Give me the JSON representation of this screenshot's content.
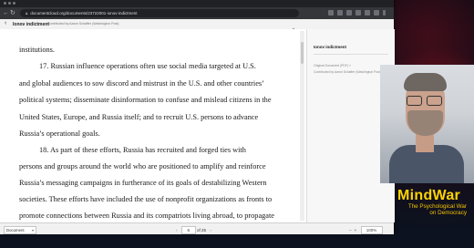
{
  "browser": {
    "url": "documentcloud.org/documents/23722001-ionov-indictment",
    "url_prefix_icon": "lock-icon"
  },
  "viewer": {
    "title": "Ionov indictment",
    "contributor": "Contributed by Aaron Schaffer (Washington Post)"
  },
  "document": {
    "lines": [
      "institutions.",
      "17.      Russian influence operations often use social media targeted at U.S.",
      "and global audiences to sow discord and mistrust in the U.S. and other countries’",
      "political systems; disseminate disinformation to confuse and mislead citizens in the",
      "United States, Europe, and Russia itself; and to recruit U.S. persons to advance",
      "Russia’s operational goals.",
      "18.      As part of these efforts, Russia has recruited and forged ties with",
      "persons and groups around the world who are positioned to amplify and reinforce",
      "Russia’s messaging campaigns in furtherance of its goals of destabilizing Western",
      "societies.   These efforts have included the use of nonprofit organizations as fronts to",
      "promote connections between Russia and its compatriots living abroad, to propagate"
    ]
  },
  "sidebar": {
    "title": "Ionov indictment",
    "original": "Original Document (PDF) »",
    "contributed": "Contributed by Aaron Schaffer (Washington Post)"
  },
  "footer": {
    "view_select": "Document",
    "page": "6",
    "of_pages": "of 25",
    "zoom": "100%"
  },
  "brand": {
    "name": "MindWar",
    "tagline1": "The Psychological War",
    "tagline2": "on Democracy",
    "color": "#ffd400"
  }
}
